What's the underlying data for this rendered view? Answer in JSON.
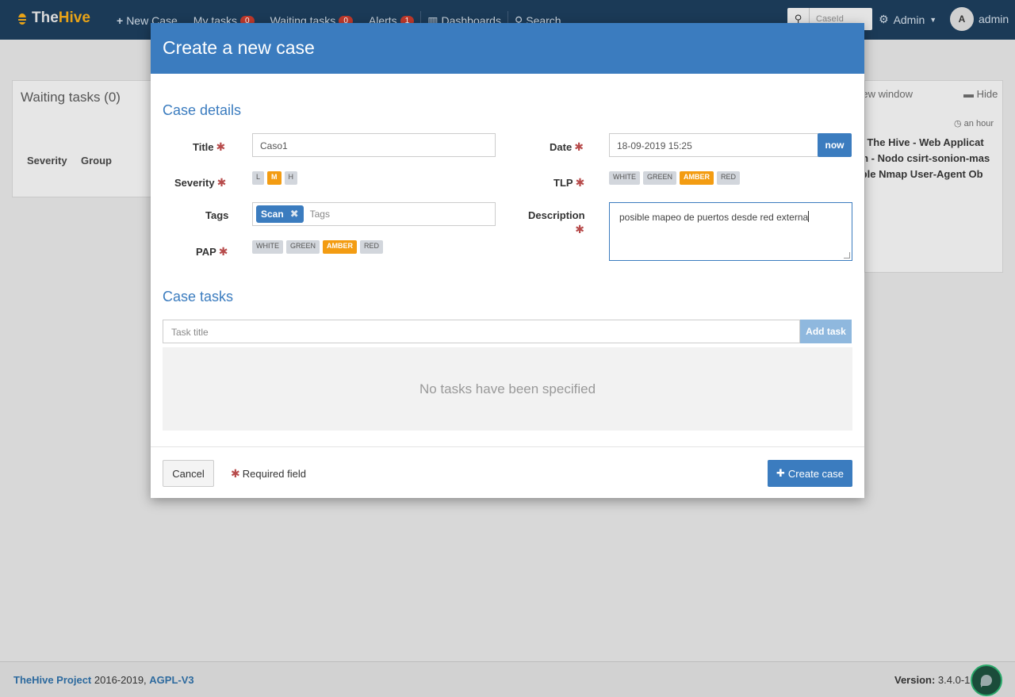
{
  "navbar": {
    "logo_prefix": "The",
    "logo_suffix": "Hive",
    "items": [
      {
        "label": "New Case",
        "icon": "plus-icon"
      },
      {
        "label": "My tasks",
        "badge": "0"
      },
      {
        "label": "Waiting tasks",
        "badge": "0"
      },
      {
        "label": "Alerts",
        "badge": "1"
      },
      {
        "label": "Dashboards",
        "icon": "bar-chart-icon"
      },
      {
        "label": "Search",
        "icon": "search-icon"
      }
    ],
    "caseid_placeholder": "CaseId",
    "admin_menu": "Admin",
    "avatar_initial": "A",
    "user": "admin"
  },
  "background": {
    "waiting_tasks_title": "Waiting tasks (0)",
    "col_severity": "Severity",
    "col_group": "Group",
    "open_new_window": "Open in new window",
    "hide": "Hide",
    "time_ago": "an hour",
    "alert_line1": "[Scan] The Hive - Web Applicat",
    "alert_line2": "Scan - Nodo csirt-sonion-mas",
    "alert_line3": "Possible Nmap User-Agent Ob"
  },
  "modal": {
    "title": "Create a new case",
    "case_details": "Case details",
    "labels": {
      "title": "Title",
      "severity": "Severity",
      "tags": "Tags",
      "pap": "PAP",
      "date": "Date",
      "tlp": "TLP",
      "description": "Description"
    },
    "required_mark": "✱",
    "title_value": "Caso1",
    "date_value": "18-09-2019 15:25",
    "now_button": "now",
    "severity_options": [
      "L",
      "M",
      "H"
    ],
    "severity_selected": "M",
    "tlp_options": [
      "WHITE",
      "GREEN",
      "AMBER",
      "RED"
    ],
    "tlp_selected": "AMBER",
    "pap_options": [
      "WHITE",
      "GREEN",
      "AMBER",
      "RED"
    ],
    "pap_selected": "AMBER",
    "tag_chip": "Scan",
    "tags_placeholder": "Tags",
    "description_value": "posible mapeo de puertos desde red externa",
    "case_tasks": "Case tasks",
    "task_placeholder": "Task title",
    "add_task": "Add task",
    "no_tasks": "No tasks have been specified",
    "cancel": "Cancel",
    "required_field": "Required field",
    "create_case": "Create case"
  },
  "footer": {
    "project": "TheHive Project",
    "years": "2016-2019,",
    "license": "AGPL-V3",
    "version_label": "Version:",
    "version_value": "3.4.0-1"
  },
  "colors": {
    "navbar": "#1b3a57",
    "modal_header": "#3b7cbf",
    "selected_pill": "#f39c12",
    "required": "#b74b4b"
  }
}
